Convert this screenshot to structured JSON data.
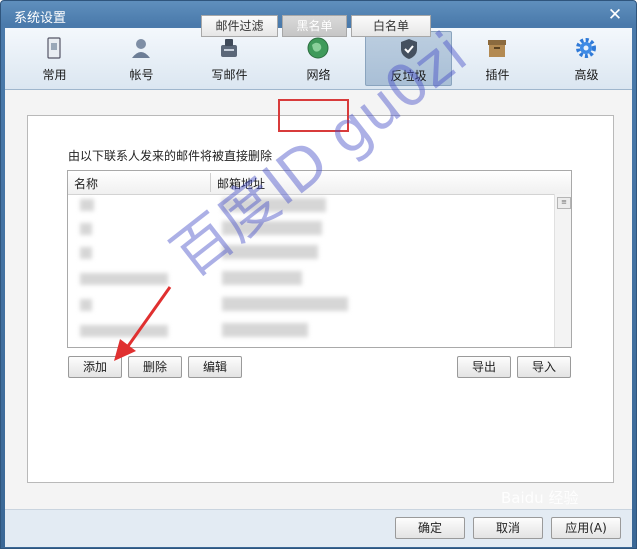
{
  "window": {
    "title": "系统设置",
    "close_label": "✕"
  },
  "toolbar": {
    "items": [
      {
        "label": "常用",
        "icon": "general-icon"
      },
      {
        "label": "帐号",
        "icon": "account-icon"
      },
      {
        "label": "写邮件",
        "icon": "compose-icon"
      },
      {
        "label": "网络",
        "icon": "network-icon"
      },
      {
        "label": "反垃圾",
        "icon": "antispam-shield-icon",
        "active": true
      },
      {
        "label": "插件",
        "icon": "plugin-icon"
      },
      {
        "label": "高级",
        "icon": "advanced-gear-icon"
      }
    ]
  },
  "subtabs": [
    {
      "label": "邮件过滤"
    },
    {
      "label": "黑名单",
      "active": true
    },
    {
      "label": "白名单"
    }
  ],
  "blacklist": {
    "description": "由以下联系人发来的邮件将被直接删除",
    "columns": [
      "名称",
      "邮箱地址"
    ]
  },
  "buttons": {
    "add": "添加",
    "delete": "删除",
    "edit": "编辑",
    "export": "导出",
    "import": "导入"
  },
  "footer": {
    "ok": "确定",
    "cancel": "取消",
    "apply": "应用(A)"
  },
  "watermark": {
    "text": "百度ID gu0zi",
    "site": "Baidu 经验"
  },
  "colors": {
    "accent": "#4a7aab",
    "highlight": "#d83b3b",
    "arrow": "#e03030"
  }
}
